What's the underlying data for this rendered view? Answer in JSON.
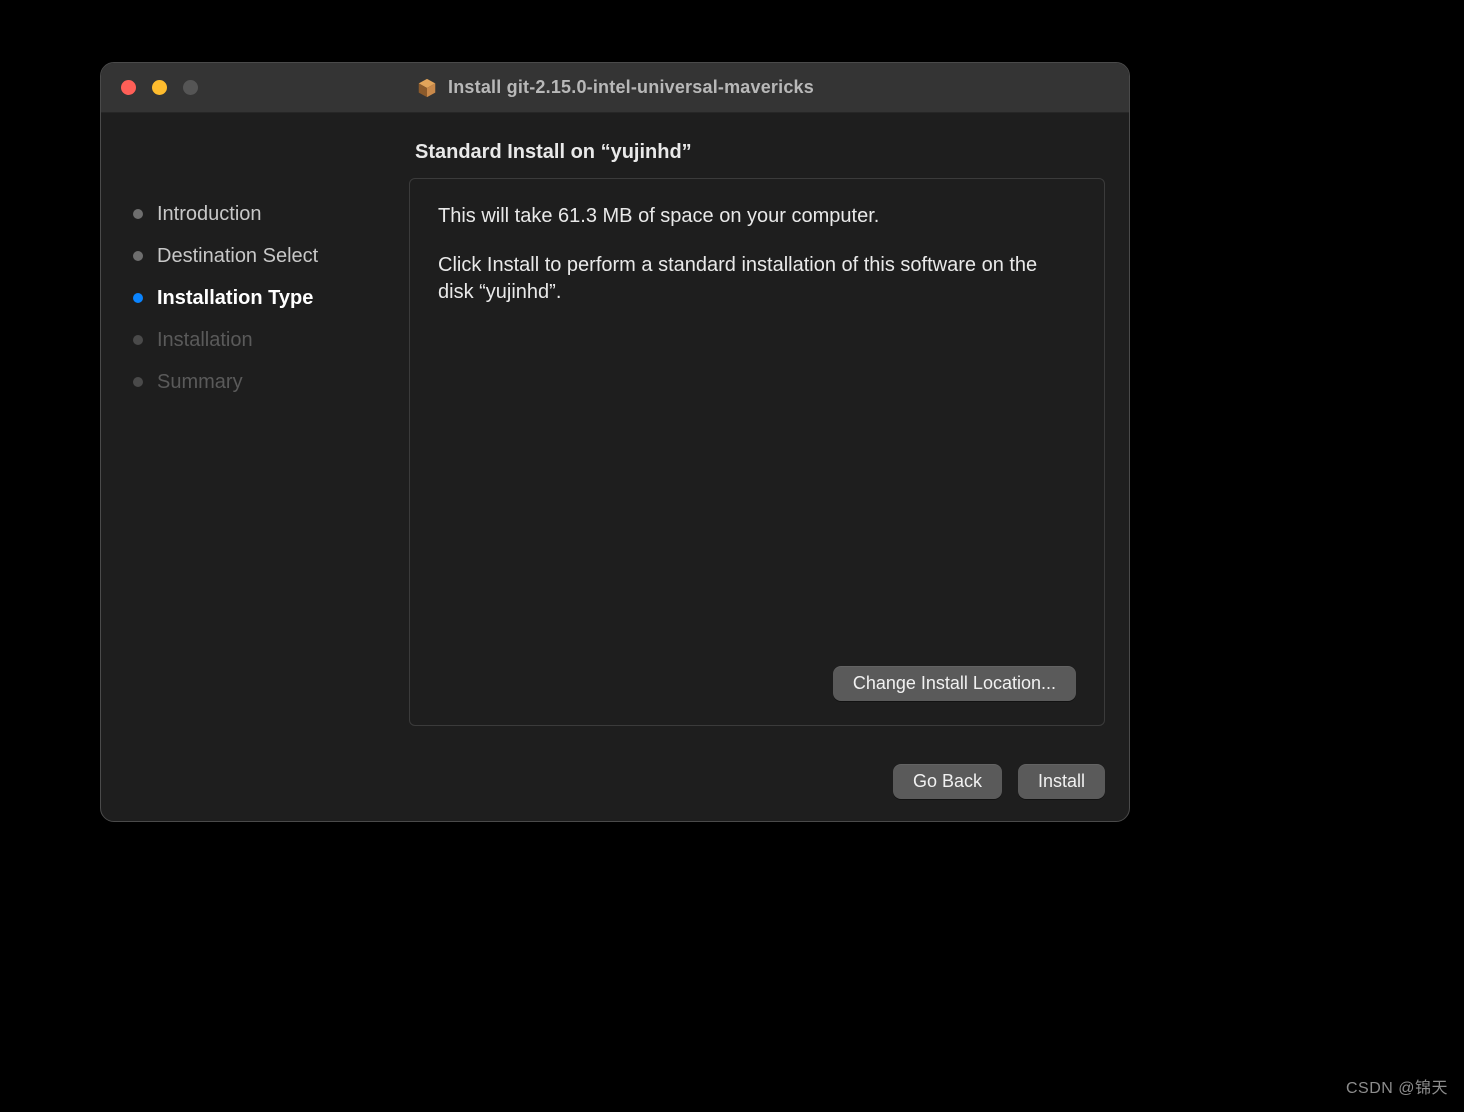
{
  "window": {
    "title": "Install git-2.15.0-intel-universal-mavericks",
    "icon": "package-icon"
  },
  "sidebar": {
    "steps": [
      {
        "label": "Introduction",
        "state": "done"
      },
      {
        "label": "Destination Select",
        "state": "done"
      },
      {
        "label": "Installation Type",
        "state": "active"
      },
      {
        "label": "Installation",
        "state": "pending"
      },
      {
        "label": "Summary",
        "state": "pending"
      }
    ]
  },
  "main": {
    "heading": "Standard Install on “yujinhd”",
    "line1": "This will take 61.3 MB of space on your computer.",
    "line2": "Click Install to perform a standard installation of this software on the disk “yujinhd”.",
    "change_location_label": "Change Install Location..."
  },
  "footer": {
    "go_back_label": "Go Back",
    "install_label": "Install"
  },
  "watermark": "CSDN @锦天"
}
